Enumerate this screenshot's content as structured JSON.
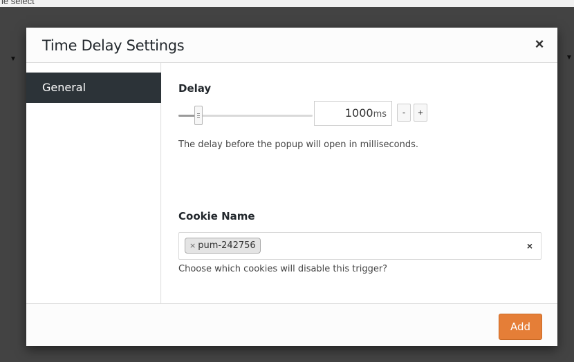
{
  "background": {
    "top_text": "le select"
  },
  "modal": {
    "title": "Time Delay Settings",
    "close_label": "×",
    "sidebar": {
      "tabs": [
        {
          "label": "General",
          "active": true
        }
      ]
    },
    "delay": {
      "label": "Delay",
      "value": "1000",
      "unit": "ms",
      "slider_fraction": 0.15,
      "minus_label": "-",
      "plus_label": "+",
      "help": "The delay before the popup will open in milliseconds."
    },
    "cookie": {
      "label": "Cookie Name",
      "tags": [
        {
          "remove_label": "×",
          "value": "pum-242756"
        }
      ],
      "clear_label": "×",
      "help": "Choose which cookies will disable this trigger?"
    },
    "footer": {
      "add_label": "Add"
    }
  },
  "colors": {
    "accent": "#e57e37",
    "active_tab": "#2c3338",
    "overlay": "#000000"
  }
}
